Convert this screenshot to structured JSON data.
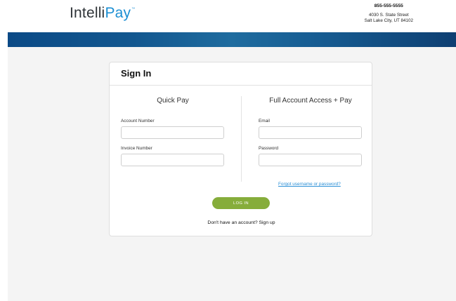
{
  "header": {
    "logo_main": "Intelli",
    "logo_accent": "Pay",
    "logo_tm": "™",
    "phone": "855-555-5555",
    "address_line1": "4030 S. State Street",
    "address_line2": "Salt Lake City, UT 84102"
  },
  "signin": {
    "title": "Sign In",
    "quick_pay": {
      "title": "Quick Pay",
      "account_label": "Account Number",
      "account_value": "",
      "invoice_label": "Invoice Number",
      "invoice_value": ""
    },
    "full_access": {
      "title": "Full Account Access + Pay",
      "email_label": "Email",
      "email_value": "",
      "password_label": "Password",
      "password_value": "",
      "forgot_link": "Forgot username or password?"
    },
    "login_button": "LOG IN",
    "signup_prompt": "Don't have an account?",
    "signup_link": "Sign up"
  },
  "colors": {
    "brand_blue": "#1c8fd3",
    "banner_blue": "#13578f",
    "login_green": "#86ad3b",
    "link_blue": "#2a8fd6",
    "page_bg": "#f4f4f4"
  }
}
